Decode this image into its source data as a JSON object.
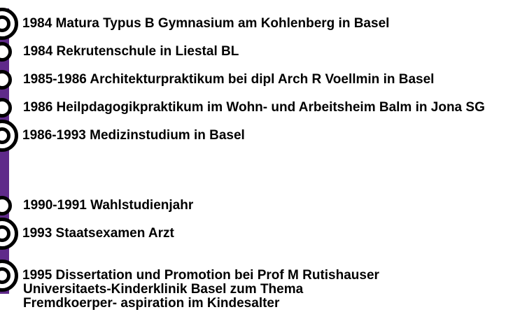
{
  "colors": {
    "timeline_bar": "#5f2a8a",
    "marker": "#000000"
  },
  "entries": [
    {
      "text": "1984 Matura Typus B Gymnasium am Kohlenberg in Basel",
      "marker": "big"
    },
    {
      "text": "1984 Rekrutenschule in Liestal BL",
      "marker": "small"
    },
    {
      "text": "1985-1986 Architekturpraktikum bei dipl Arch R Voellmin in Basel",
      "marker": "small"
    },
    {
      "text": "1986 Heilpdagogikpraktikum im Wohn- und Arbeitsheim Balm in Jona SG",
      "marker": "small"
    },
    {
      "text": "1986-1993 Medizinstudium in Basel",
      "marker": "big"
    },
    {
      "text": "1990-1991 Wahlstudienjahr",
      "marker": "small"
    },
    {
      "text": "1993 Staatsexamen Arzt",
      "marker": "big"
    },
    {
      "lines": [
        "1995 Dissertation und Promotion bei Prof M Rutishauser",
        "Universitaets-Kinderklinik Basel zum Thema",
        "Fremdkoerper- aspiration im Kindesalter"
      ],
      "marker": "big"
    }
  ]
}
